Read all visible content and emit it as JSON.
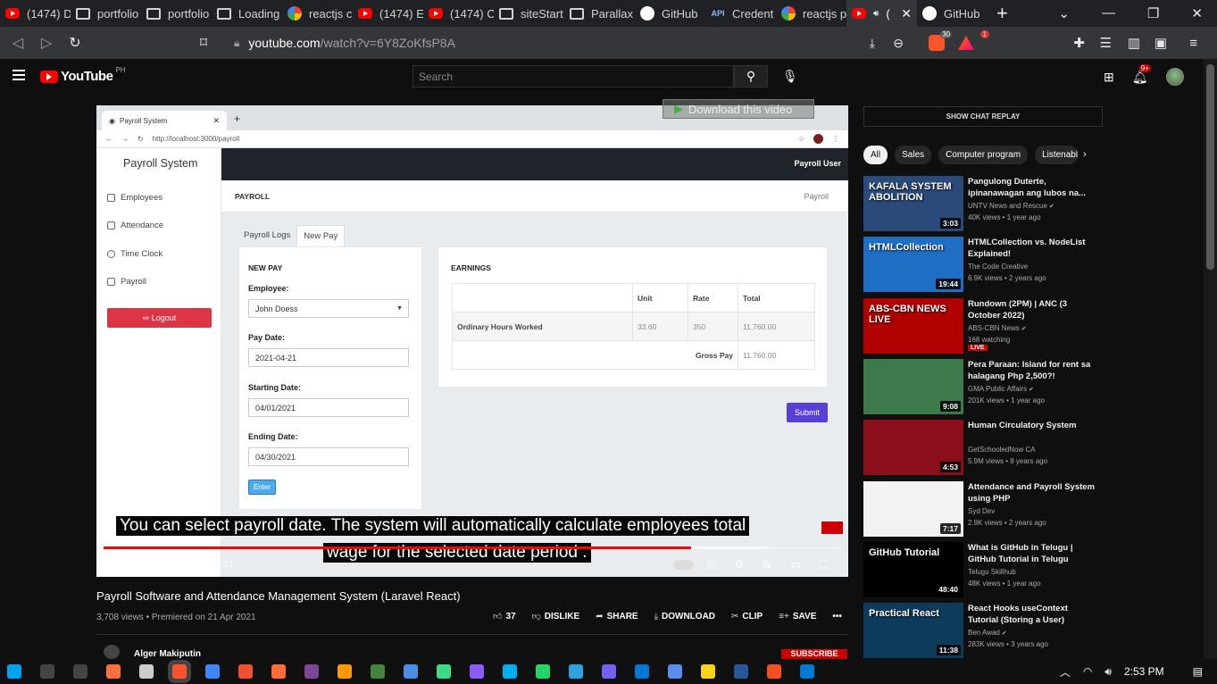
{
  "browser": {
    "tabs": [
      {
        "title": "(1474) D",
        "icon": "youtube-icon"
      },
      {
        "title": "portfolio",
        "icon": "page-icon"
      },
      {
        "title": "portfolio",
        "icon": "page-icon"
      },
      {
        "title": "Loading",
        "icon": "page-icon"
      },
      {
        "title": "reactjs c",
        "icon": "google-icon"
      },
      {
        "title": "(1474) E",
        "icon": "youtube-icon"
      },
      {
        "title": "(1474) C",
        "icon": "youtube-icon"
      },
      {
        "title": "siteStart",
        "icon": "page-icon"
      },
      {
        "title": "Parallax",
        "icon": "page-icon"
      },
      {
        "title": "GitHub",
        "icon": "github-icon"
      },
      {
        "title": "Credent",
        "icon": "api-icon",
        "prefix": "API"
      },
      {
        "title": "reactjs p",
        "icon": "google-icon"
      },
      {
        "title": "(",
        "icon": "youtube-icon",
        "active": true
      },
      {
        "title": "GitHub",
        "icon": "github-icon"
      }
    ],
    "url_host": "youtube.com",
    "url_path": "/watch?v=6Y8ZoKfsP8A",
    "brave_shield_count": "30",
    "rewards_badge": "1"
  },
  "youtube": {
    "logo_text": "YouTube",
    "country_code": "PH",
    "search_placeholder": "Search",
    "notification_count": "9+"
  },
  "player": {
    "download_label": "Download this video",
    "app": {
      "tab_title": "Payroll System",
      "url": "http://localhost:3000/payroll",
      "brand": "Payroll System",
      "user": "Payroll User",
      "sidebar": [
        "Employees",
        "Attendance",
        "Time Clock",
        "Payroll"
      ],
      "logout": "Logout",
      "breadcrumb_title": "PAYROLL",
      "breadcrumb_right": "Payroll",
      "tabs": [
        "Payroll Logs",
        "New Pay"
      ],
      "new_pay": {
        "heading": "NEW PAY",
        "employee_label": "Employee:",
        "employee_value": "John Doess",
        "pay_date_label": "Pay Date:",
        "pay_date_value": "2021-04-21",
        "start_label": "Starting Date:",
        "start_value": "04/01/2021",
        "end_label": "Ending Date:",
        "end_value": "04/30/2021",
        "enter": "Enter"
      },
      "earnings": {
        "heading": "EARNINGS",
        "headers": [
          "",
          "Unit",
          "Rate",
          "Total"
        ],
        "row_label": "Ordinary Hours Worked",
        "row_unit": "33.60",
        "row_rate": "350",
        "row_total": "11,760.00",
        "gross_label": "Gross Pay",
        "gross_value": "11,760.00"
      },
      "submit": "Submit"
    },
    "subtitle_line1": "You can select payroll date. The system will automatically calculate employees total",
    "subtitle_line2": "wage for the selected date period .",
    "time": "2:45 / 3:27",
    "progress_fraction": 0.797,
    "buffer_fraction": 0.9
  },
  "video": {
    "title": "Payroll Software and Attendance Management System (Laravel React)",
    "meta": "3,708 views • Premiered on 21 Apr 2021",
    "likes": "37",
    "dislike": "DISLIKE",
    "share": "SHARE",
    "download": "DOWNLOAD",
    "clip": "CLIP",
    "save": "SAVE",
    "channel": "Alger Makiputin",
    "subscribe": "SUBSCRIBE"
  },
  "sidebar": {
    "chat_replay": "SHOW CHAT REPLAY",
    "chips": [
      "All",
      "Sales",
      "Computer program",
      "Listenable"
    ],
    "recommendations": [
      {
        "title": "Pangulong Duterte, ipinanawagan ang lubos na...",
        "channel": "UNTV News and Rescue",
        "verified": true,
        "views": "40K views • 1 year ago",
        "duration": "3:03",
        "thumb_color": "#2a4a7a",
        "thumb_text": "KAFALA SYSTEM ABOLITION"
      },
      {
        "title": "HTMLCollection vs. NodeList Explained!",
        "channel": "The Code Creative",
        "verified": false,
        "views": "6.9K views • 2 years ago",
        "duration": "19:44",
        "thumb_color": "#1e6fc4",
        "thumb_text": "HTMLCollection"
      },
      {
        "title": "Rundown (2PM) | ANC (3 October 2022)",
        "channel": "ABS-CBN News",
        "verified": true,
        "views": "168 watching",
        "live": "LIVE",
        "duration": "",
        "thumb_color": "#b00000",
        "thumb_text": "ABS-CBN NEWS LIVE"
      },
      {
        "title": "Pera Paraan: Island for rent sa halagang Php 2,500?!",
        "channel": "GMA Public Affairs",
        "verified": true,
        "views": "201K views • 1 year ago",
        "duration": "9:08",
        "thumb_color": "#3d7a4a",
        "thumb_text": ""
      },
      {
        "title": "Human Circulatory System",
        "channel": "GetSchooledNow CA",
        "verified": false,
        "views": "5.9M views • 8 years ago",
        "duration": "4:53",
        "thumb_color": "#8a0f1a",
        "thumb_text": ""
      },
      {
        "title": "Attendance and Payroll System using PHP",
        "channel": "Syd Dev",
        "verified": false,
        "views": "2.9K views • 2 years ago",
        "duration": "7:17",
        "thumb_color": "#f2f2f2",
        "thumb_text": ""
      },
      {
        "title": "What is GitHub in Telugu | GitHub Tutorial in Telugu",
        "channel": "Telugu Skillhub",
        "verified": false,
        "views": "48K views • 1 year ago",
        "duration": "48:40",
        "thumb_color": "#000000",
        "thumb_text": "GitHub Tutorial"
      },
      {
        "title": "React Hooks useContext Tutorial (Storing a User)",
        "channel": "Ben Awad",
        "verified": true,
        "views": "283K views • 3 years ago",
        "duration": "11:38",
        "thumb_color": "#0d3b5c",
        "thumb_text": "Practical React"
      }
    ]
  },
  "taskbar": {
    "time": "2:53 PM"
  }
}
